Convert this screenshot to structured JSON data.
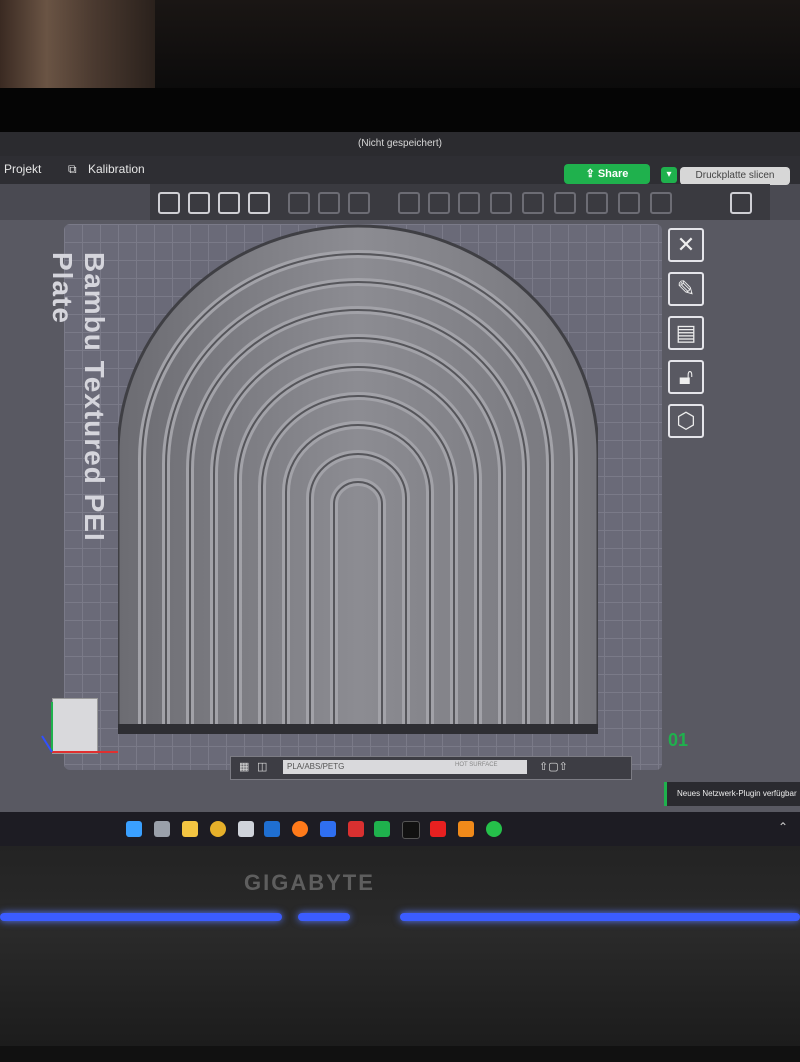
{
  "window": {
    "title": "(Nicht gespeichert)"
  },
  "menu": {
    "project": "Projekt",
    "calibration": "Kalibration"
  },
  "header": {
    "share_label": "Share",
    "slice_label": "Druckplatte slicen"
  },
  "plate": {
    "label": "Bambu Textured PEI Plate",
    "number": "01"
  },
  "filament": {
    "material": "PLA/ABS/PETG",
    "surface": "HOT SURFACE"
  },
  "notification": {
    "text": "Neues Netzwerk-Plugin verfügbar"
  },
  "laptop": {
    "brand": "GIGABYTE"
  },
  "colors": {
    "accent": "#1fb14d",
    "plate": "#6a6a78",
    "model": "#8a8a90"
  },
  "icons": {
    "toolbar": [
      "add-cube-icon",
      "grid-icon",
      "auto-orient-icon",
      "arrange-icon",
      "copy-icon",
      "plate-icon",
      "layers-icon",
      "move-icon",
      "rotate-icon",
      "scale-icon",
      "cut-icon",
      "support-icon",
      "seam-icon",
      "mesh-boolean-icon",
      "text-icon",
      "paint-icon",
      "assembly-icon"
    ],
    "right": [
      "close-icon",
      "edit-plate-icon",
      "layout-icon",
      "unlock-icon",
      "settings-icon"
    ]
  }
}
